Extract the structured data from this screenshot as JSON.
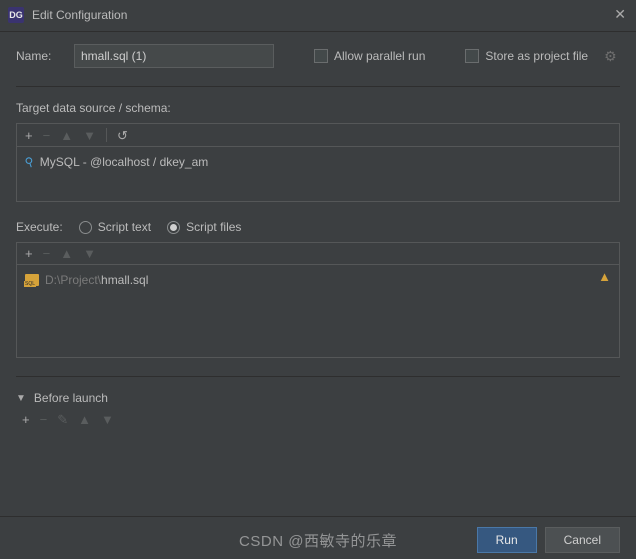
{
  "titlebar": {
    "app_badge": "DG",
    "title": "Edit Configuration"
  },
  "name": {
    "label": "Name:",
    "value": "hmall.sql (1)"
  },
  "options": {
    "allow_parallel": "Allow parallel run",
    "store_project": "Store as project file"
  },
  "datasource": {
    "label": "Target data source / schema:",
    "item": "MySQL - @localhost / dkey_am"
  },
  "execute": {
    "label": "Execute:",
    "opt_text": "Script text",
    "opt_files": "Script files"
  },
  "file": {
    "path_prefix": "D:\\Project\\",
    "path_name": "hmall.sql"
  },
  "before_launch": {
    "label": "Before launch"
  },
  "buttons": {
    "run": "Run",
    "cancel": "Cancel"
  },
  "watermark": "CSDN @西敏寺的乐章"
}
